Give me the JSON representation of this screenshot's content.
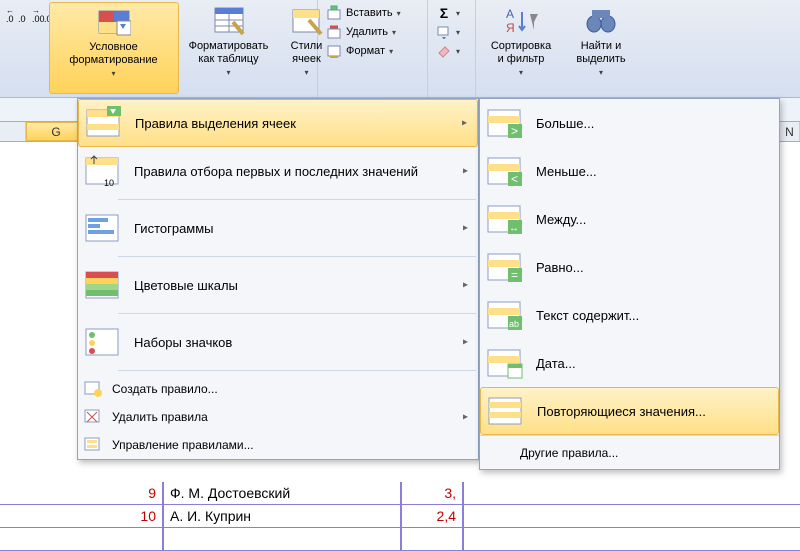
{
  "ribbon": {
    "dec_inc": ".0\n.00",
    "dec_dec": ".00\n.0",
    "cond_fmt": "Условное\nформатирование",
    "fmt_table": "Форматировать\nкак таблицу",
    "cell_styles": "Стили\nячеек",
    "insert": "Вставить",
    "delete": "Удалить",
    "format": "Формат",
    "sigma": "Σ",
    "fill": "Заливка",
    "clear": "Очистить",
    "sort_filter": "Сортировка\nи фильтр",
    "find_select": "Найти и\nвыделить"
  },
  "columns": {
    "G": "G",
    "N": "N"
  },
  "menu1": {
    "i1": "Правила выделения ячеек",
    "i2": "Правила отбора первых и последних значений",
    "i3": "Гистограммы",
    "i4": "Цветовые шкалы",
    "i5": "Наборы значков",
    "i6": "Создать правило...",
    "i7": "Удалить правила",
    "i8": "Управление правилами..."
  },
  "menu2": {
    "i1": "Больше...",
    "i2": "Меньше...",
    "i3": "Между...",
    "i4": "Равно...",
    "i5": "Текст содержит...",
    "i6": "Дата...",
    "i7": "Повторяющиеся значения...",
    "other": "Другие правила..."
  },
  "table": {
    "rows": [
      {
        "n": "9",
        "name": "Ф. М. Достоевский",
        "val": "3,"
      },
      {
        "n": "10",
        "name": "А. И. Куприн",
        "val": "2,4"
      },
      {
        "n": "",
        "name": "",
        "val": ""
      }
    ]
  }
}
